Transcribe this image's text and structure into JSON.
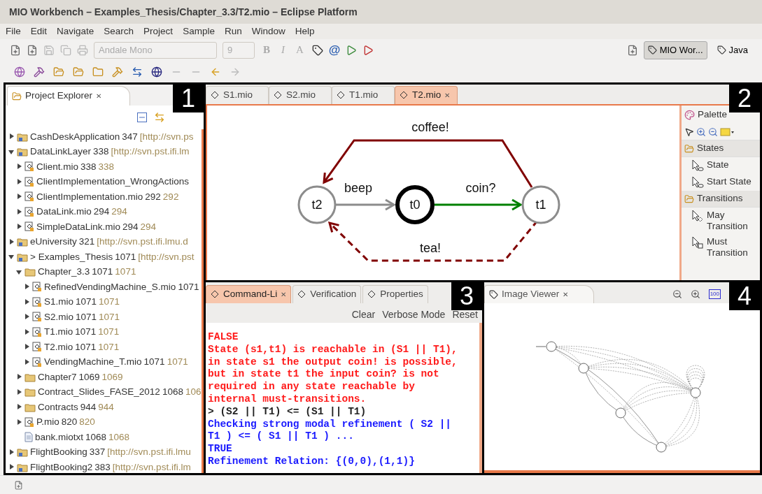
{
  "window": {
    "title": "MIO Workbench – Examples_Thesis/Chapter_3.3/T2.mio – Eclipse Platform"
  },
  "menu": [
    "File",
    "Edit",
    "Navigate",
    "Search",
    "Project",
    "Sample",
    "Run",
    "Window",
    "Help"
  ],
  "toolbar": {
    "font_combo": {
      "value": "Andale Mono",
      "disabled": true
    },
    "size_combo": {
      "value": "9",
      "disabled": true
    },
    "format_buttons": [
      "B",
      "I",
      "A"
    ],
    "at_button": "@",
    "perspectives": [
      {
        "label": "MIO Wor...",
        "selected": true
      },
      {
        "label": "Java",
        "selected": false
      }
    ]
  },
  "explorer": {
    "tab": {
      "label": "Project Explorer",
      "close": "✕"
    },
    "marker": "1",
    "tree": [
      {
        "kind": "project",
        "label": "CashDeskApplication",
        "rev": "347",
        "info": "[http://svn.ps",
        "expanded": false
      },
      {
        "kind": "project",
        "label": "DataLinkLayer",
        "rev": "338",
        "info": "[http://svn.pst.ifi.lm",
        "expanded": true,
        "children": [
          {
            "kind": "mio",
            "label": "Client.mio",
            "rev": "338",
            "info": "338",
            "expanded": false
          },
          {
            "kind": "mio",
            "label": "ClientImplementation_WrongActions",
            "expanded": false
          },
          {
            "kind": "mio",
            "label": "ClientImplementation.mio",
            "rev": "292",
            "info": "292",
            "expanded": false
          },
          {
            "kind": "mio",
            "label": "DataLink.mio",
            "rev": "294",
            "info": "294",
            "expanded": false
          },
          {
            "kind": "mio",
            "label": "SimpleDataLink.mio",
            "rev": "294",
            "info": "294",
            "expanded": false
          }
        ]
      },
      {
        "kind": "project",
        "label": "eUniversity",
        "rev": "321",
        "info": "[http://svn.pst.ifi.lmu.d",
        "expanded": false
      },
      {
        "kind": "project",
        "label": "> Examples_Thesis",
        "rev": "1071",
        "info": "[http://svn.pst",
        "expanded": true,
        "children": [
          {
            "kind": "folder",
            "label": "Chapter_3.3",
            "rev": "1071",
            "info": "1071",
            "expanded": true,
            "children": [
              {
                "kind": "mio",
                "label": "RefinedVendingMachine_S.mio",
                "rev": "1071",
                "expanded": false
              },
              {
                "kind": "mio",
                "label": "S1.mio",
                "rev": "1071",
                "info": "1071",
                "expanded": false
              },
              {
                "kind": "mio",
                "label": "S2.mio",
                "rev": "1071",
                "info": "1071",
                "expanded": false
              },
              {
                "kind": "mio",
                "label": "T1.mio",
                "rev": "1071",
                "info": "1071",
                "expanded": false
              },
              {
                "kind": "mio",
                "label": "T2.mio",
                "rev": "1071",
                "info": "1071",
                "expanded": false
              },
              {
                "kind": "mio",
                "label": "VendingMachine_T.mio",
                "rev": "1071",
                "info": "1071",
                "expanded": false
              }
            ]
          },
          {
            "kind": "folder",
            "label": "Chapter7",
            "rev": "1069",
            "info": "1069",
            "expanded": false
          },
          {
            "kind": "folder",
            "label": "Contract_Slides_FASE_2012",
            "rev": "1068",
            "info": "106",
            "expanded": false
          },
          {
            "kind": "folder",
            "label": "Contracts",
            "rev": "944",
            "info": "944",
            "expanded": false
          },
          {
            "kind": "mio",
            "label": "P.mio",
            "rev": "820",
            "info": "820",
            "expanded": false
          },
          {
            "kind": "text",
            "label": "bank.miotxt",
            "rev": "1068",
            "info": "1068"
          }
        ]
      },
      {
        "kind": "project",
        "label": "FlightBooking",
        "rev": "337",
        "info": "[http://svn.pst.ifi.lmu",
        "expanded": false
      },
      {
        "kind": "project",
        "label": "FlightBooking2",
        "rev": "383",
        "info": "[http://svn.pst.ifi.lm",
        "expanded": false
      }
    ]
  },
  "editor": {
    "marker": "2",
    "tabs": [
      {
        "label": "S1.mio",
        "selected": false
      },
      {
        "label": "S2.mio",
        "selected": false
      },
      {
        "label": "T1.mio",
        "selected": false
      },
      {
        "label": "T2.mio",
        "selected": true,
        "close": "✕"
      }
    ],
    "diagram": {
      "states": [
        {
          "label": "t2",
          "initial": false
        },
        {
          "label": "t0",
          "initial": true
        },
        {
          "label": "t1",
          "initial": false
        }
      ],
      "transitions": [
        {
          "label": "coffee!",
          "dashed": false,
          "color": "#800000"
        },
        {
          "label": "beep",
          "dashed": false,
          "color": "#8c8c8c"
        },
        {
          "label": "coin?",
          "dashed": false,
          "color": "#008000"
        },
        {
          "label": "tea!",
          "dashed": true,
          "color": "#800000"
        }
      ]
    },
    "palette": {
      "title": "Palette",
      "drawers": [
        {
          "label": "States",
          "items": [
            {
              "label": "State",
              "kind": "state"
            },
            {
              "label": "Start State",
              "kind": "state"
            }
          ]
        },
        {
          "label": "Transitions",
          "items": [
            {
              "label": "May Transition",
              "kind": "may"
            },
            {
              "label": "Must Transition",
              "kind": "must"
            }
          ]
        }
      ]
    }
  },
  "console_panel": {
    "marker": "3",
    "tabs": [
      {
        "label": "Command-Li",
        "selected": true,
        "close": "✕"
      },
      {
        "label": "Verification",
        "selected": false
      },
      {
        "label": "Properties",
        "selected": false
      }
    ],
    "actions": [
      "Clear",
      "Verbose Mode",
      "Reset"
    ],
    "lines": [
      {
        "text": "FALSE",
        "kind": "error"
      },
      {
        "text": "State (s1,t1) is reachable in (S1 || T1),",
        "kind": "error"
      },
      {
        "text": "in state s1 the output coin! is possible,",
        "kind": "error"
      },
      {
        "text": "but in state t1 the input coin? is not",
        "kind": "error"
      },
      {
        "text": "required in any state reachable by",
        "kind": "error"
      },
      {
        "text": "internal must-transitions.",
        "kind": "error"
      },
      {
        "text": "> (S2 || T1) <= (S1 || T1)",
        "kind": "input"
      },
      {
        "text": "Checking strong modal refinement ( S2 ||",
        "kind": "info"
      },
      {
        "text": "T1 ) <= ( S1 || T1 ) ...",
        "kind": "info"
      },
      {
        "text": "TRUE",
        "kind": "info"
      },
      {
        "text": "Refinement Relation: {(0,0),(1,1)}",
        "kind": "info"
      }
    ]
  },
  "image_viewer": {
    "marker": "4",
    "tab": {
      "label": "Image Viewer",
      "close": "✕"
    },
    "zoom_label": "100"
  }
}
